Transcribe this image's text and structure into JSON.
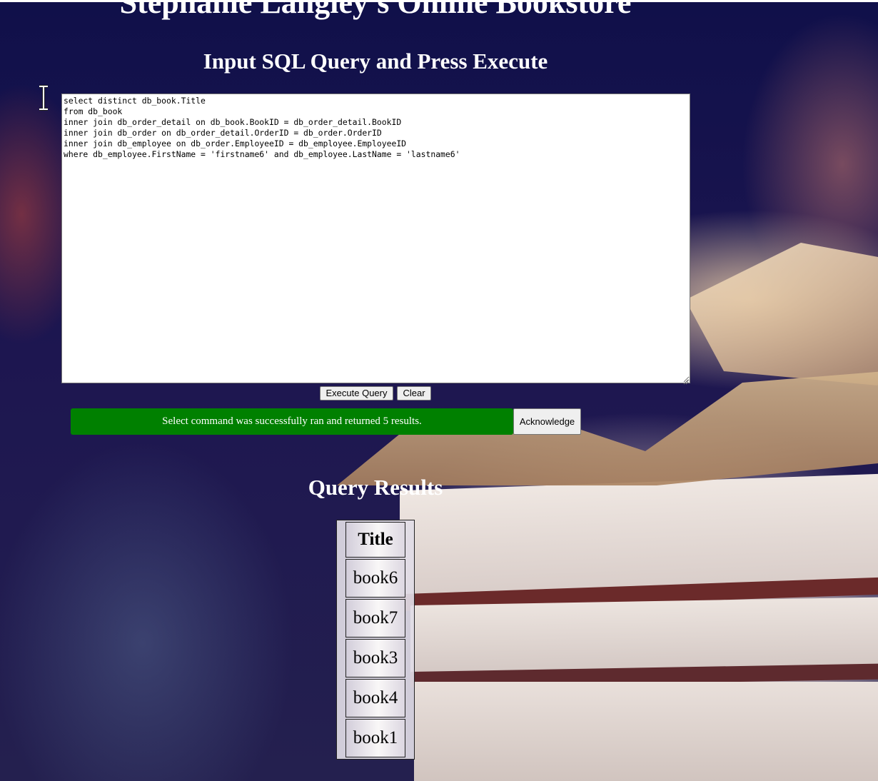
{
  "page": {
    "site_title": "Stephanie Langley's Online Bookstore",
    "sql_section_title": "Input SQL Query and Press Execute",
    "results_section_title": "Query Results"
  },
  "query": {
    "text": "select distinct db_book.Title\nfrom db_book\ninner join db_order_detail on db_book.BookID = db_order_detail.BookID\ninner join db_order on db_order_detail.OrderID = db_order.OrderID\ninner join db_employee on db_order.EmployeeID = db_employee.EmployeeID\nwhere db_employee.FirstName = 'firstname6' and db_employee.LastName = 'lastname6'"
  },
  "buttons": {
    "execute_label": "Execute Query",
    "clear_label": "Clear",
    "acknowledge_label": "Acknowledge"
  },
  "alert": {
    "message": "Select command was successfully ran and returned 5 results.",
    "color": "#008000"
  },
  "results": {
    "columns": [
      "Title"
    ],
    "rows": [
      [
        "book6"
      ],
      [
        "book7"
      ],
      [
        "book3"
      ],
      [
        "book4"
      ],
      [
        "book1"
      ]
    ]
  },
  "icons": {
    "cursor": "text-cursor-icon",
    "grip": "resize-grip-icon"
  }
}
